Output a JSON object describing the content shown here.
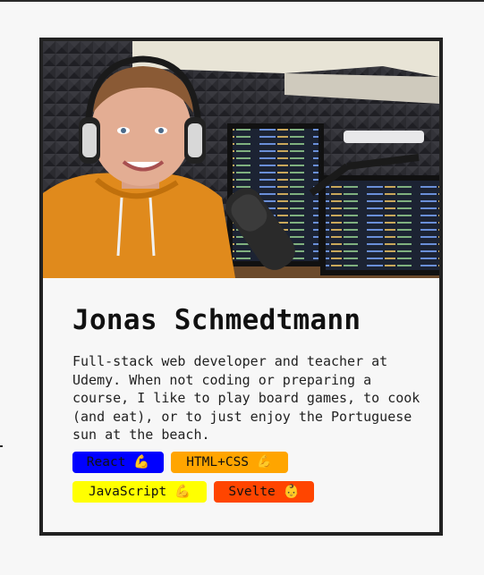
{
  "profile": {
    "name": "Jonas Schmedtmann",
    "bio": "Full-stack web developer and teacher at Udemy. When not coding or preparing a course, I like to play board games, to cook (and eat), or to just enjoy the Portuguese sun at the beach.",
    "photo_icon": "profile-photo"
  },
  "skills": [
    {
      "label": "React 💪",
      "color": "#0000ff"
    },
    {
      "label": "HTML+CSS 💪",
      "color": "#ffa500"
    },
    {
      "label": "JavaScript 💪",
      "color": "#ffff00"
    },
    {
      "label": "Svelte 👶",
      "color": "#ff4500"
    }
  ]
}
